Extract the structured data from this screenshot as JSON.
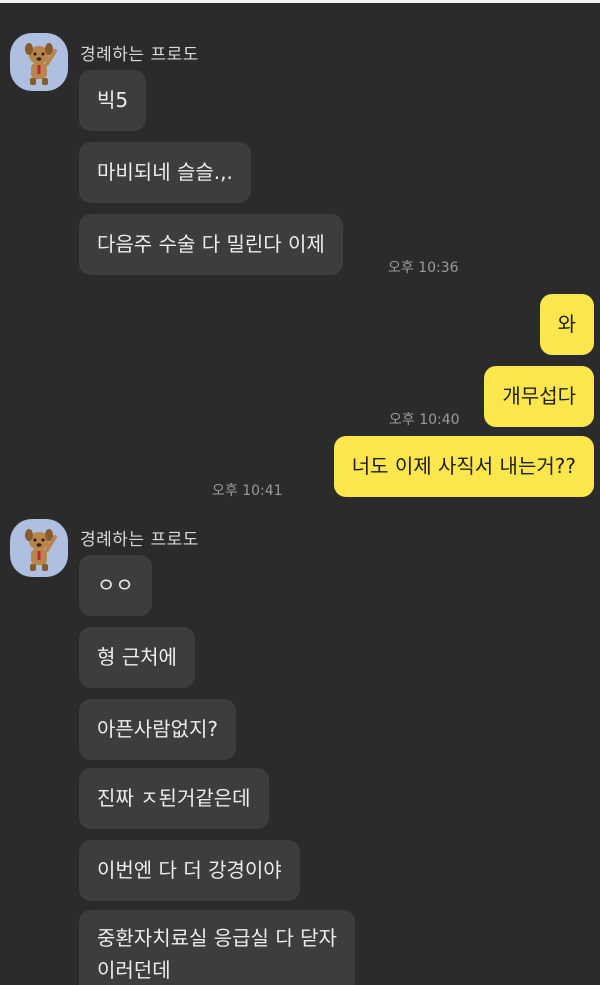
{
  "sender_name": "경례하는 프로도",
  "messages": {
    "m1": "빅5",
    "m2": "마비되네 슬슬.,.",
    "m3": "다음주 수술 다 밀린다 이제",
    "m4": "와",
    "m5": "개무섭다",
    "m6": "너도 이제 사직서 내는거??",
    "m7": "ㅇㅇ",
    "m8": "형 근처에",
    "m9": "아픈사람없지?",
    "m10": "진짜 ㅈ된거같은데",
    "m11": "이번엔 다 더 강경이야",
    "m12_line1": "중환자치료실 응급실 다 닫자",
    "m12_line2": "이러던데"
  },
  "times": {
    "t1": "오후 10:36",
    "t2": "오후 10:40",
    "t3": "오후 10:41"
  },
  "colors": {
    "background": "#2b2b2b",
    "incoming_bubble": "#3d3d3d",
    "outgoing_bubble": "#fbe74d",
    "avatar_bg": "#aebfe0"
  },
  "icons": {
    "avatar": "frodo-saluting-dog-avatar"
  }
}
